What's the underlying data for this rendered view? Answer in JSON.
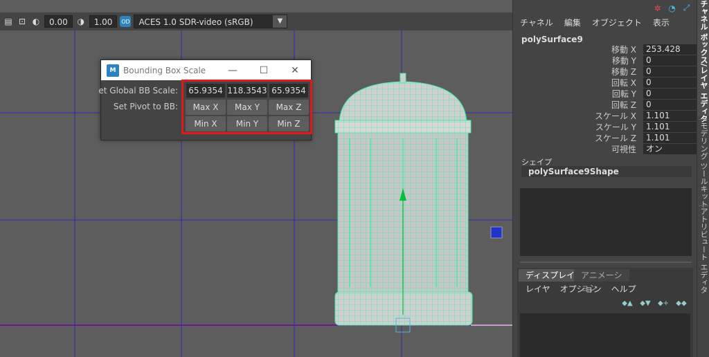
{
  "viewport_toolbar": {
    "exposure_value": "0.00",
    "gamma_value": "1.00",
    "color_space": "ACES 1.0 SDR-video (sRGB)",
    "icons": [
      "camera-icon",
      "isolate-icon",
      "exposure-icon",
      "gamma-icon",
      "colorspace-icon"
    ]
  },
  "dialog": {
    "title": "Bounding Box Scale",
    "icon_text": "M",
    "set_global_label": "et Global BB Scale:",
    "set_pivot_label": "Set Pivot to BB:",
    "scale_values": [
      "65.9354",
      "118.3543",
      "65.9354"
    ],
    "max_buttons": [
      "Max  X",
      "Max  Y",
      "Max  Z"
    ],
    "min_buttons": [
      "Min  X",
      "Min  Y",
      "Min  Z"
    ],
    "minimize": "—",
    "maximize": "☐",
    "close": "✕"
  },
  "channel_box": {
    "menu": [
      "チャネル",
      "編集",
      "オブジェクト",
      "表示"
    ],
    "object_name": "polySurface9",
    "attributes": [
      {
        "label": "移動 X",
        "value": "253.428"
      },
      {
        "label": "移動 Y",
        "value": "0"
      },
      {
        "label": "移動 Z",
        "value": "0"
      },
      {
        "label": "回転 X",
        "value": "0"
      },
      {
        "label": "回転 Y",
        "value": "0"
      },
      {
        "label": "回転 Z",
        "value": "0"
      },
      {
        "label": "スケール X",
        "value": "1.101"
      },
      {
        "label": "スケール Y",
        "value": "1.101"
      },
      {
        "label": "スケール Z",
        "value": "1.101"
      },
      {
        "label": "可視性",
        "value": "オン"
      }
    ],
    "shape_header": "シェイプ",
    "shape_name": "polySurface9Shape"
  },
  "layer_panel": {
    "tabs": [
      "ディスプレイ",
      "アニメーション"
    ],
    "menu": [
      "レイヤ",
      "オプション",
      "ヘルプ"
    ]
  },
  "side_tabs": [
    "チャネル ボックス/レイヤ エディタ",
    "モデリング ツールキット",
    "アトリビュート エディタ"
  ],
  "colors": {
    "wireframe": "#3bf0a6",
    "highlight": "#e0191b",
    "grid": "#2a2ab0",
    "horizon": "#7a00a8"
  }
}
